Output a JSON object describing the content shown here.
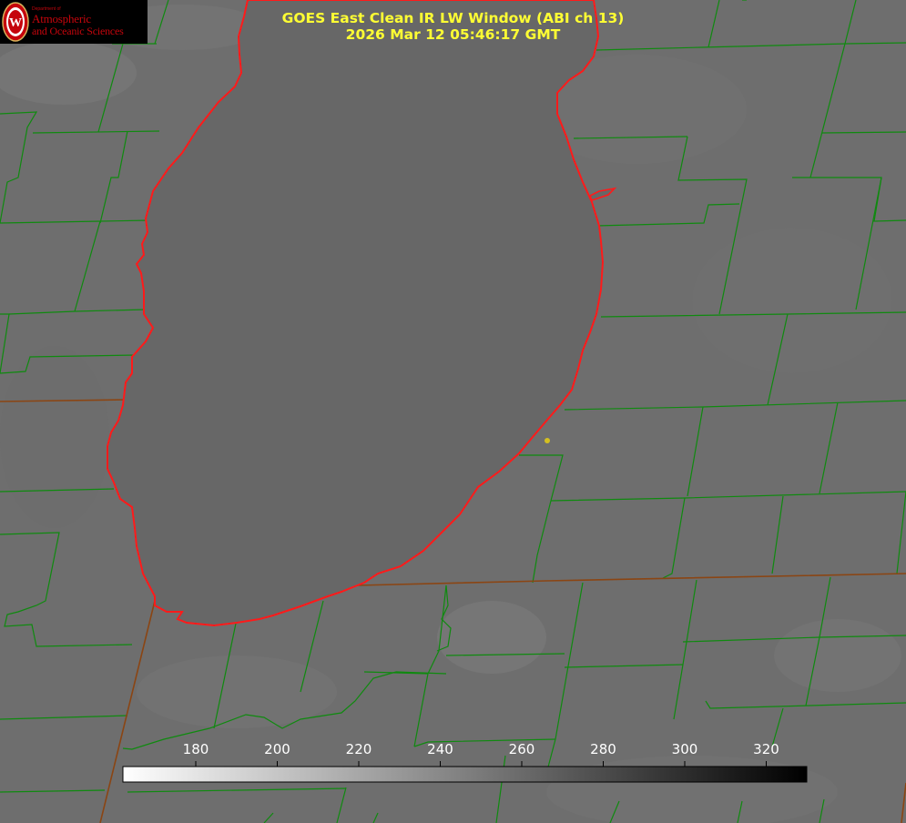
{
  "logo": {
    "department_text": "Department of",
    "line1": "Atmospheric",
    "line2": "and Oceanic Sciences",
    "seal_letter": "W"
  },
  "header": {
    "title": "GOES East Clean IR LW Window (ABI ch 13)",
    "timestamp": "2026 Mar 12 05:46:17 GMT"
  },
  "colorbar": {
    "ticks": [
      "180",
      "200",
      "220",
      "240",
      "260",
      "280",
      "300",
      "320"
    ],
    "colors": {
      "start": "#ffffff",
      "end": "#000000"
    }
  },
  "colors": {
    "lake_fill": "#676767",
    "land_fill": "#6e6e6e",
    "county_border": "#0f8a0f",
    "state_border": "#8b4513",
    "coastline": "#ff1a1a",
    "title_text": "#ffff33",
    "marker": "#d4c020",
    "logo_red": "#c5050c"
  }
}
